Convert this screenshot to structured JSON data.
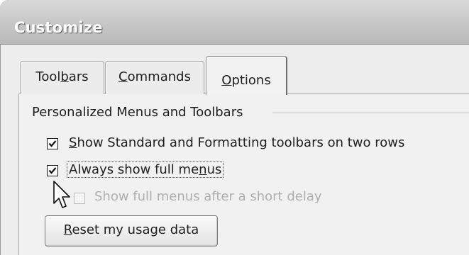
{
  "window": {
    "title": "Customize"
  },
  "tabs": [
    {
      "pre": "Tool",
      "acc": "b",
      "post": "ars"
    },
    {
      "pre": "",
      "acc": "C",
      "post": "ommands"
    },
    {
      "pre": "",
      "acc": "O",
      "post": "ptions",
      "selected": true
    }
  ],
  "group": {
    "label": "Personalized Menus and Toolbars"
  },
  "options": [
    {
      "pre": "",
      "acc": "S",
      "post": "how Standard and Formatting toolbars on two rows",
      "checked": true,
      "enabled": true
    },
    {
      "pre": "Always show full me",
      "acc": "n",
      "post": "us",
      "checked": true,
      "enabled": true,
      "focused": true
    },
    {
      "pre": "Show full menus after a short delay",
      "acc": "",
      "post": "",
      "checked": false,
      "enabled": false
    }
  ],
  "reset_button": {
    "pre": "",
    "acc": "R",
    "post": "eset my usage data"
  },
  "icons": {
    "checkbox_mark": "checkmark-icon",
    "pointer": "arrow-cursor-icon"
  },
  "colors": {
    "titlebar": "#c8c8c8",
    "dialog": "#ededed",
    "disabled_text": "#aeaeae"
  }
}
